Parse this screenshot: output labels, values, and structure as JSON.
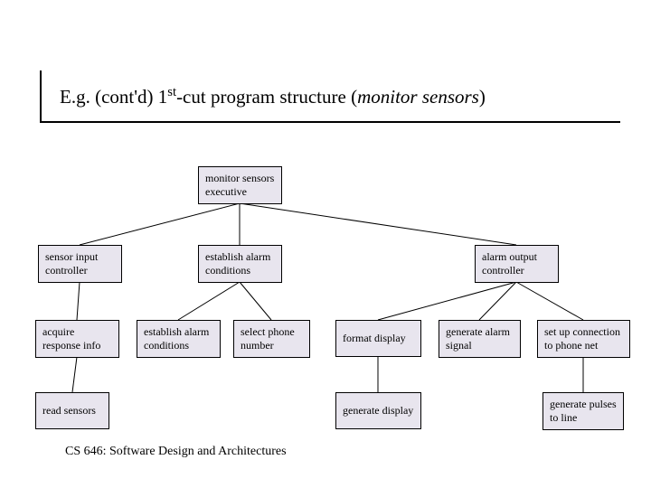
{
  "title_html": "E.g. (cont'd) 1<sup>st</sup>-cut program structure (<em>monitor sensors</em>)",
  "footer": "CS 646: Software Design and Architectures",
  "boxes": {
    "root": "monitor sensors\nexecutive",
    "l2_sensor_input": "sensor input\ncontroller",
    "l2_establish": "establish alarm\nconditions",
    "l2_alarm_output": "alarm output\ncontroller",
    "l3_acquire": "acquire\nresponse info",
    "l3_establish": "establish alarm\nconditions",
    "l3_select_phone": "select phone\nnumber",
    "l3_format_display": "format display",
    "l3_generate_alarm": "generate alarm\nsignal",
    "l3_setup_conn": "set up connection\nto phone net",
    "l4_read_sensors": "read sensors",
    "l4_generate_display": "generate display",
    "l4_generate_pulses": "generate pulses\nto line"
  }
}
